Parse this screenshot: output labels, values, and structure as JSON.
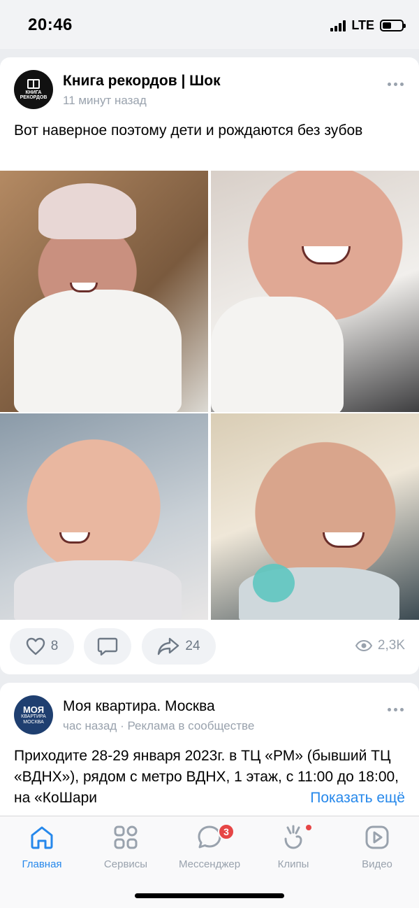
{
  "status_bar": {
    "time": "20:46",
    "network": "LTE",
    "battery_level": 0.45
  },
  "posts": [
    {
      "author": "Книга рекордов | Шок",
      "avatar_text": "КНИГА РЕКОРДОВ",
      "time": "11 минут назад",
      "text": "Вот наверное поэтому дети и рождаются без зубов",
      "photos": [
        "baby-photo-1",
        "baby-photo-2",
        "baby-photo-3",
        "baby-photo-4"
      ],
      "likes": "8",
      "shares": "24",
      "views": "2,3K",
      "icons": {
        "like": "heart-icon",
        "comment": "comment-icon",
        "share": "share-icon",
        "views": "eye-icon",
        "menu": "more-dots-icon"
      }
    },
    {
      "author": "Моя квартира. Москва",
      "avatar_text": "МОЯ",
      "avatar_subtext": "КВАРТИРА",
      "avatar_city": "МОСКВА",
      "time": "час назад · Реклама в сообществе",
      "text": "Приходите 28-29 января 2023г. в ТЦ «РМ» (бывший ТЦ «ВДНХ»), рядом с метро ВДНХ, 1 этаж, с 11:00 до 18:00, на «КоШари",
      "show_more": "Показать ещё"
    }
  ],
  "tab_bar": {
    "tabs": [
      {
        "label": "Главная",
        "icon": "home-icon",
        "active": true
      },
      {
        "label": "Сервисы",
        "icon": "services-icon"
      },
      {
        "label": "Мессенджер",
        "icon": "messenger-icon",
        "badge": "3"
      },
      {
        "label": "Клипы",
        "icon": "clips-icon"
      },
      {
        "label": "Видео",
        "icon": "video-icon"
      }
    ]
  },
  "colors": {
    "accent": "#2688eb",
    "badge": "#e64646",
    "secondary_text": "#99a2ad",
    "background": "#ebedf0"
  }
}
